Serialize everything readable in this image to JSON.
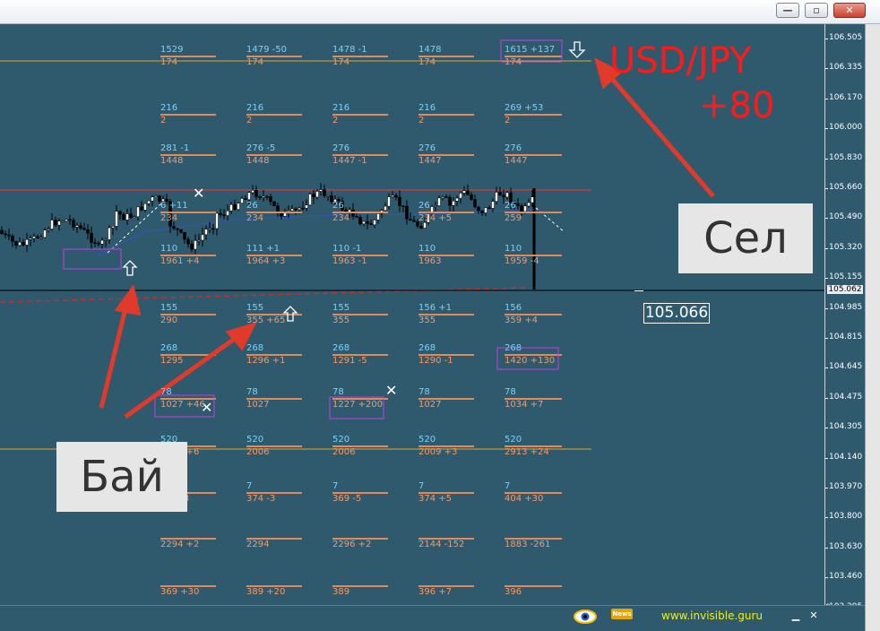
{
  "window": {
    "minimize_icon": "minimize-icon",
    "restore_icon": "restore-icon",
    "close_icon": "close-icon"
  },
  "annotations": {
    "pair": "USD/JPY",
    "profit": "+80",
    "sell_label": "Сел",
    "buy_label": "Бай",
    "current_price_box": "105.066"
  },
  "axis": {
    "ticks": [
      "106.505",
      "106.335",
      "106.170",
      "106.000",
      "105.830",
      "105.660",
      "105.490",
      "105.320",
      "105.155",
      "104.985",
      "104.815",
      "104.645",
      "104.475",
      "104.305",
      "104.140",
      "103.970",
      "103.800",
      "103.630",
      "103.460",
      "103.295"
    ],
    "current_price": "105.062",
    "corner_label": "0"
  },
  "levels": {
    "columns": [
      [
        "1529",
        "174",
        "216",
        "2",
        "281 -1",
        "1448",
        "6 +11",
        "234",
        "110",
        "1961 +4",
        "155",
        "290",
        "268",
        "1295",
        "78",
        "1027 +46",
        "520",
        "2069 +6",
        "7",
        "377 -3",
        "2294 +2",
        "369 +30"
      ],
      [
        "1479 -50",
        "174",
        "216",
        "2",
        "276 -5",
        "1448",
        "26",
        "234",
        "111 +1",
        "1964 +3",
        "155",
        "355 +65",
        "268",
        "1296 +1",
        "78",
        "1027",
        "520",
        "2006",
        "7",
        "374 -3",
        "2294",
        "389 +20"
      ],
      [
        "1478 -1",
        "174",
        "216",
        "2",
        "276",
        "1447 -1",
        "26",
        "234",
        "110 -1",
        "1963 -1",
        "155",
        "355",
        "268",
        "1291 -5",
        "78",
        "1227 +200",
        "520",
        "2006",
        "7",
        "369 -5",
        "2296 +2",
        "389"
      ],
      [
        "1478",
        "174",
        "216",
        "2",
        "276",
        "1447",
        "26",
        "234 +5",
        "110",
        "1963",
        "156 +1",
        "355",
        "268",
        "1290 -1",
        "78",
        "1027",
        "520",
        "2009 +3",
        "7",
        "374 +5",
        "2144 -152",
        "396 +7"
      ],
      [
        "1615 +137",
        "174",
        "269 +53",
        "2",
        "276",
        "1447",
        "26",
        "259",
        "110",
        "1959 -4",
        "156",
        "359 +4",
        "268",
        "1420 +130",
        "78",
        "1034 +7",
        "520",
        "2913 +24",
        "7",
        "404 +30",
        "1883 -261",
        "396"
      ]
    ]
  },
  "bottom_bar": {
    "site": "www.invisible.guru",
    "news": "News",
    "eye_icon": "eye-icon"
  },
  "colors": {
    "background": "#2f5a6e",
    "volume_blue": "#7fd0f5",
    "volume_orange": "#f29a69",
    "arrow_red": "#e23a2a",
    "pair_red": "#ff1a1a",
    "highlight_magenta": "#c040e0"
  }
}
